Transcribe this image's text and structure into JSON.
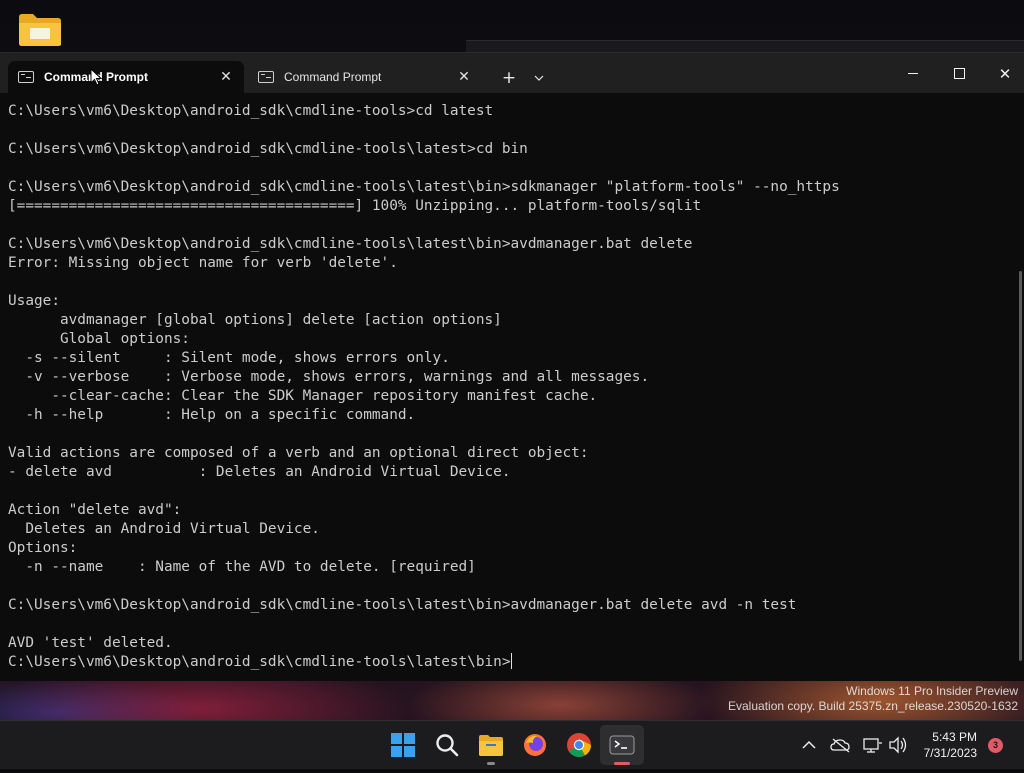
{
  "desktop": {
    "watermark_line1": "Windows 11 Pro Insider Preview",
    "watermark_line2": "Evaluation copy. Build 25375.zn_release.230520-1632"
  },
  "terminal": {
    "tabs": [
      {
        "title": "Command Prompt",
        "active": true,
        "close": "✕"
      },
      {
        "title": "Command Prompt",
        "active": false,
        "close": "✕"
      }
    ],
    "new_tab_glyph": "+",
    "dropdown_glyph": "⌄",
    "close_glyph": "✕",
    "lines": [
      "C:\\Users\\vm6\\Desktop\\android_sdk\\cmdline-tools>cd latest",
      "",
      "C:\\Users\\vm6\\Desktop\\android_sdk\\cmdline-tools\\latest>cd bin",
      "",
      "C:\\Users\\vm6\\Desktop\\android_sdk\\cmdline-tools\\latest\\bin>sdkmanager \"platform-tools\" --no_https",
      "[=======================================] 100% Unzipping... platform-tools/sqlit",
      "",
      "C:\\Users\\vm6\\Desktop\\android_sdk\\cmdline-tools\\latest\\bin>avdmanager.bat delete",
      "Error: Missing object name for verb 'delete'.",
      "",
      "Usage:",
      "      avdmanager [global options] delete [action options]",
      "      Global options:",
      "  -s --silent     : Silent mode, shows errors only.",
      "  -v --verbose    : Verbose mode, shows errors, warnings and all messages.",
      "     --clear-cache: Clear the SDK Manager repository manifest cache.",
      "  -h --help       : Help on a specific command.",
      "",
      "Valid actions are composed of a verb and an optional direct object:",
      "- delete avd          : Deletes an Android Virtual Device.",
      "",
      "Action \"delete avd\":",
      "  Deletes an Android Virtual Device.",
      "Options:",
      "  -n --name    : Name of the AVD to delete. [required]",
      "",
      "C:\\Users\\vm6\\Desktop\\android_sdk\\cmdline-tools\\latest\\bin>avdmanager.bat delete avd -n test",
      "",
      "AVD 'test' deleted."
    ],
    "prompt": "C:\\Users\\vm6\\Desktop\\android_sdk\\cmdline-tools\\latest\\bin>"
  },
  "taskbar": {
    "icons": [
      "windows-start-icon",
      "search-icon",
      "file-explorer-icon",
      "firefox-icon",
      "chrome-icon",
      "terminal-icon"
    ],
    "clock_time": "5:43 PM",
    "clock_date": "7/31/2023",
    "notification_count": "3",
    "colors": {
      "accent": "#e35a67"
    }
  }
}
